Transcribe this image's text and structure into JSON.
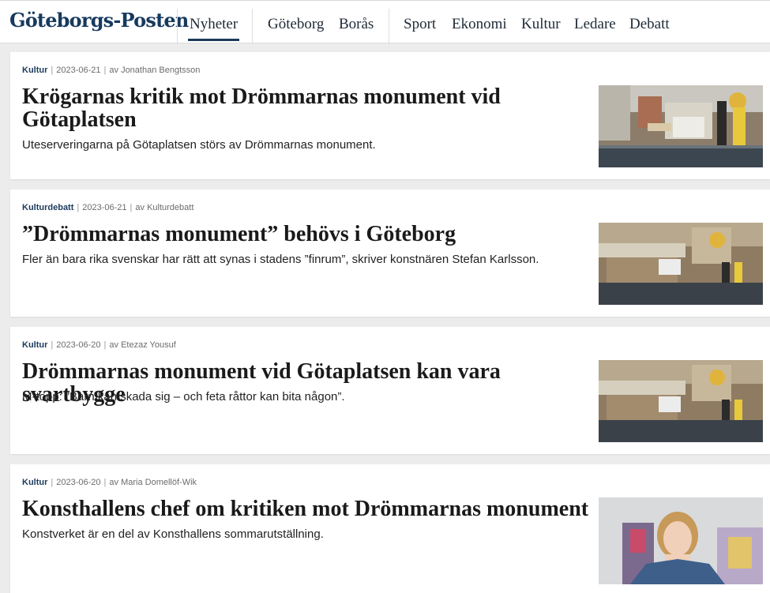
{
  "header": {
    "logo": "Göteborgs-Posten",
    "nav": [
      "Nyheter",
      "Göteborg",
      "Borås",
      "Sport",
      "Ekonomi",
      "Kultur",
      "Ledare",
      "Debatt"
    ],
    "active": "Nyheter"
  },
  "articles": [
    {
      "category": "Kultur",
      "date": "2023-06-21",
      "author": "av Jonathan Bengtsson",
      "title": "Krögarnas kritik mot Drömmarnas monument vid Götaplatsen",
      "lead": "Uteserveringarna på Götaplatsen störs av Drömmarnas monument."
    },
    {
      "category": "Kulturdebatt",
      "date": "2023-06-21",
      "author": "av Kulturdebatt",
      "title": "”Drömmarnas monument” behövs i Göteborg",
      "lead": "Fler än bara rika svenskar har rätt att synas i stadens ”finrum”, skriver konstnären Stefan Karlsson."
    },
    {
      "category": "Kultur",
      "date": "2023-06-20",
      "author": "av Etezaz Yousuf",
      "title": "Drömmarnas monument vid Götaplatsen kan vara svartbygge",
      "lead": "M-topp: ”Barn kan skada sig – och feta råttor kan bita någon”."
    },
    {
      "category": "Kultur",
      "date": "2023-06-20",
      "author": "av Maria Domellöf-Wik",
      "title": "Konsthallens chef om kritiken mot Drömmarnas monument",
      "lead": "Konstverket är en del av Konsthallens sommarutställning."
    }
  ],
  "colors": {
    "brand": "#173a5e",
    "category": "#1c3a5c",
    "background": "#ececec"
  }
}
